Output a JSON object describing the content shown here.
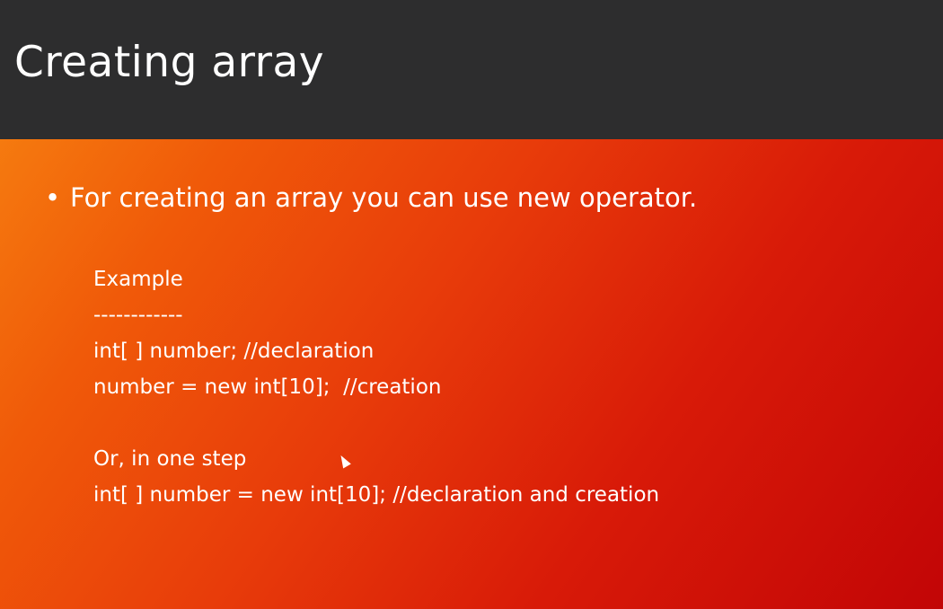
{
  "slide": {
    "title": "Creating array",
    "bullet_marker": "•",
    "bullet_text": "For creating an array you can use new operator.",
    "example": {
      "heading": "Example",
      "rule": "------------",
      "line1": "int[ ] number; //declaration",
      "line2": "number = new int[10];  //creation",
      "alt_heading": "Or, in one step",
      "line3": "int[ ] number = new int[10]; //declaration and creation"
    }
  },
  "colors": {
    "title_bar": "#2d2d2e",
    "gradient_start": "#f57a0f",
    "gradient_end": "#c20506",
    "text": "#ffffff"
  },
  "icons": {
    "cursor": "mouse-pointer-icon"
  }
}
